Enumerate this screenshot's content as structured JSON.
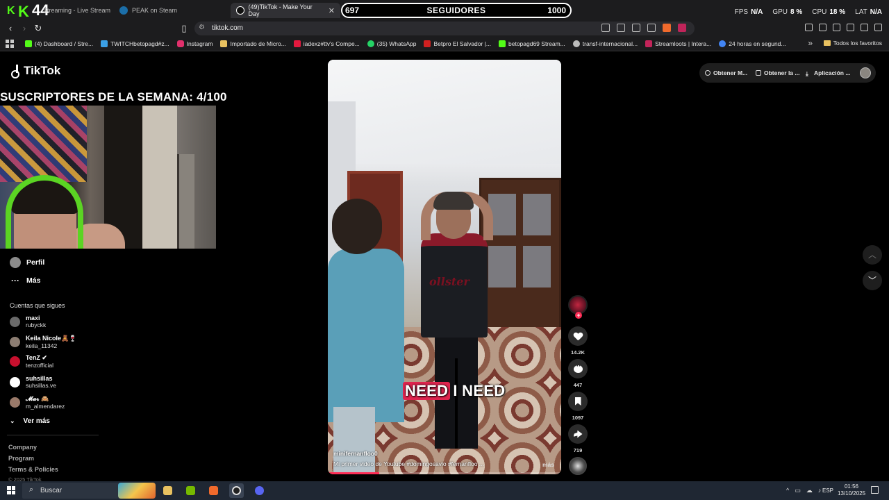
{
  "browser": {
    "brand_number": "44",
    "tabs": [
      {
        "label": "Streaming - Live Stream",
        "color": "#53fc18"
      },
      {
        "label": "PEAK on Steam",
        "color": "#1b6ea8"
      },
      {
        "label": "(49)TikTok - Make Your Day",
        "color": "#ffffff",
        "active": true
      }
    ],
    "url": "tiktok.com",
    "bookmarks": [
      {
        "label": "(4) Dashboard / Stre...",
        "color": "#53fc18"
      },
      {
        "label": "TWITCHbetopagd#z...",
        "color": "#3ba0e6"
      },
      {
        "label": "Instagram",
        "color": "#e1306c"
      },
      {
        "label": "Importado de Micro...",
        "color": "#e8c160"
      },
      {
        "label": "iadexz#ttv's Compe...",
        "color": "#e3193e"
      },
      {
        "label": "(35) WhatsApp",
        "color": "#25d366"
      },
      {
        "label": "Betpro El Salvador |...",
        "color": "#d02020"
      },
      {
        "label": "betopagd69 Stream...",
        "color": "#53fc18"
      },
      {
        "label": "transf-internacional...",
        "color": "#bbbbbb"
      },
      {
        "label": "Streamloots | Intera...",
        "color": "#c3245a"
      },
      {
        "label": "24 horas en segund...",
        "color": "#4285f4"
      }
    ],
    "all_bookmarks": "Todos los favoritos"
  },
  "overlay": {
    "followers_current": "697",
    "followers_label": "SEGUIDORES",
    "followers_goal": "1000",
    "stats": [
      {
        "label": "FPS",
        "value": "N/A"
      },
      {
        "label": "GPU",
        "value": "8 %"
      },
      {
        "label": "CPU",
        "value": "18 %"
      },
      {
        "label": "LAT",
        "value": "N/A"
      }
    ],
    "sub_goal": "SUSCRIPTORES DE LA SEMANA: 4/100"
  },
  "tiktok": {
    "logo": "TikTok",
    "nav": [
      {
        "label": "Perfil"
      },
      {
        "label": "Más"
      }
    ],
    "following_title": "Cuentas que sigues",
    "following": [
      {
        "name": "maxi",
        "user": "rubyckk",
        "color": "#6a6a6a"
      },
      {
        "name": "Keila Nicole🧸🍷",
        "user": "keila_11342",
        "color": "#8c7d72"
      },
      {
        "name": "TenZ ✔",
        "user": "tenzofficial",
        "color": "#c8102e"
      },
      {
        "name": "suhsillas",
        "user": "suhsillas.ve",
        "color": "#ffffff"
      },
      {
        "name": "𝓜𝓪𝓻 🙈",
        "user": "m_almendarez",
        "color": "#9a7a6a"
      }
    ],
    "see_more": "Ver más",
    "footer": [
      "Company",
      "Program",
      "Terms & Policies"
    ],
    "copyright": "© 2025 TikTok",
    "top_actions": [
      {
        "label": "Obtener M..."
      },
      {
        "label": "Obtener la ..."
      },
      {
        "label": "Aplicación ..."
      }
    ],
    "video": {
      "caption_words": [
        "NEED",
        "I NEED"
      ],
      "author": "minifernanfloo0",
      "description": "Mi primer video de Youtube #domingosavio #fernanfloo ...",
      "more": "más",
      "shirt_text": "ollster",
      "progress": 0.22
    },
    "actions": {
      "likes": "14.2K",
      "comments": "447",
      "saves": "1097",
      "shares": "719"
    }
  },
  "taskbar": {
    "search": "Buscar",
    "lang": "ESP",
    "time": "01:56",
    "date": "13/10/2025"
  }
}
